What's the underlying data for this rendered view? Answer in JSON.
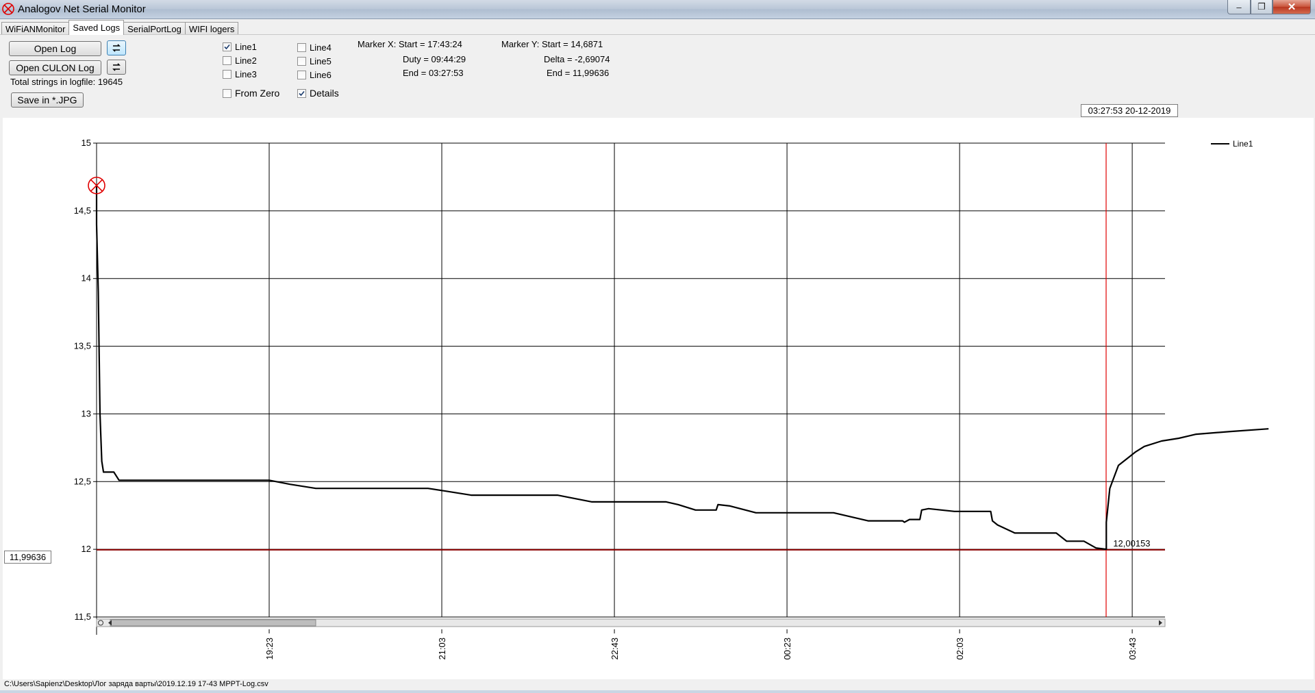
{
  "window": {
    "title": "Analogov Net Serial Monitor",
    "icon": "app-logo-icon",
    "controls": [
      "minimize-icon",
      "maximize-icon",
      "close-icon"
    ]
  },
  "tabs": [
    {
      "label": "WiFiANMonitor",
      "active": false
    },
    {
      "label": "Saved Logs",
      "active": true
    },
    {
      "label": "SerialPortLog",
      "active": false
    },
    {
      "label": "WIFI logers",
      "active": false
    }
  ],
  "toolbar": {
    "open_log": "Open Log",
    "open_culon_log": "Open CULON Log",
    "refresh_icon": "refresh-icon",
    "total_strings": "Total strings in logfile: 19645",
    "save_jpg": "Save in *.JPG"
  },
  "checkboxes": [
    {
      "label": "Line1",
      "checked": true
    },
    {
      "label": "Line2",
      "checked": false
    },
    {
      "label": "Line3",
      "checked": false
    },
    {
      "label": "Line4",
      "checked": false
    },
    {
      "label": "Line5",
      "checked": false
    },
    {
      "label": "Line6",
      "checked": false
    },
    {
      "label": "From Zero",
      "checked": false
    },
    {
      "label": "Details",
      "checked": true
    }
  ],
  "markers": {
    "x": {
      "start": "Marker X: Start = 17:43:24",
      "duty": "Duty = 09:44:29",
      "end": "End  = 03:27:53"
    },
    "y": {
      "start": "Marker Y: Start = 14,6871",
      "delta": "Delta = -2,69074",
      "end": "End  = 11,99636"
    }
  },
  "date_box": "03:27:53 20-12-2019",
  "value_box": "11,99636",
  "status_path": "C:\\Users\\Sapienz\\Desktop\\Лог заряда варты\\2019.12.19 17-43 MPPT-Log.csv",
  "colors": {
    "line": "#000000",
    "grid": "#000000",
    "marker_y": "#8b0000",
    "marker_x": "#e00000"
  },
  "chart_data": {
    "type": "line",
    "x_unit": "time",
    "xlim": [
      "17:43",
      "04:02"
    ],
    "ylim": [
      11.5,
      15
    ],
    "y_ticks": [
      "11,5",
      "12",
      "12,5",
      "13",
      "13,5",
      "14",
      "14,5",
      "15"
    ],
    "x_ticks": [
      "19:23",
      "21:03",
      "22:43",
      "00:23",
      "02:03",
      "03:43"
    ],
    "grid": true,
    "legend": "top-right",
    "series": [
      {
        "name": "Line1",
        "points": [
          [
            "17:43",
            14.69
          ],
          [
            "17:43",
            14.4
          ],
          [
            "17:44",
            13.9
          ],
          [
            "17:45",
            13.0
          ],
          [
            "17:46",
            12.65
          ],
          [
            "17:47",
            12.57
          ],
          [
            "17:53",
            12.57
          ],
          [
            "17:56",
            12.51
          ],
          [
            "19:23",
            12.51
          ],
          [
            "19:35",
            12.48
          ],
          [
            "19:50",
            12.45
          ],
          [
            "20:55",
            12.45
          ],
          [
            "21:05",
            12.43
          ],
          [
            "21:20",
            12.4
          ],
          [
            "22:10",
            12.4
          ],
          [
            "22:30",
            12.35
          ],
          [
            "23:13",
            12.35
          ],
          [
            "23:20",
            12.33
          ],
          [
            "23:30",
            12.29
          ],
          [
            "23:42",
            12.29
          ],
          [
            "23:43",
            12.33
          ],
          [
            "23:50",
            12.32
          ],
          [
            "24:05",
            12.27
          ],
          [
            "24:50",
            12.27
          ],
          [
            "25:00",
            12.24
          ],
          [
            "25:10",
            12.21
          ],
          [
            "25:30",
            12.21
          ],
          [
            "25:31",
            12.2
          ],
          [
            "25:34",
            12.22
          ],
          [
            "25:40",
            12.22
          ],
          [
            "25:41",
            12.29
          ],
          [
            "25:45",
            12.3
          ],
          [
            "26:00",
            12.28
          ],
          [
            "26:21",
            12.28
          ],
          [
            "26:22",
            12.21
          ],
          [
            "26:25",
            12.18
          ],
          [
            "26:35",
            12.12
          ],
          [
            "26:59",
            12.12
          ],
          [
            "27:05",
            12.06
          ],
          [
            "27:15",
            12.06
          ],
          [
            "27:22",
            12.01
          ],
          [
            "27:28",
            12.0
          ],
          [
            "27:28",
            12.2
          ],
          [
            "27:30",
            12.45
          ],
          [
            "27:35",
            12.62
          ],
          [
            "27:45",
            12.72
          ],
          [
            "27:50",
            12.76
          ],
          [
            "28:00",
            12.8
          ],
          [
            "28:10",
            12.82
          ],
          [
            "28:20",
            12.85
          ],
          [
            "28:40",
            12.87
          ],
          [
            "29:02",
            12.89
          ]
        ]
      }
    ],
    "marker_x": {
      "start": "17:43:24",
      "end": "03:27:53"
    },
    "marker_y": {
      "end": 11.99636
    },
    "point_label": {
      "text": "12,00153",
      "x": "03:28",
      "y": 12.00153
    },
    "start_marker": {
      "x": "17:43",
      "y": 14.6871,
      "icon": "target-marker-icon"
    }
  }
}
